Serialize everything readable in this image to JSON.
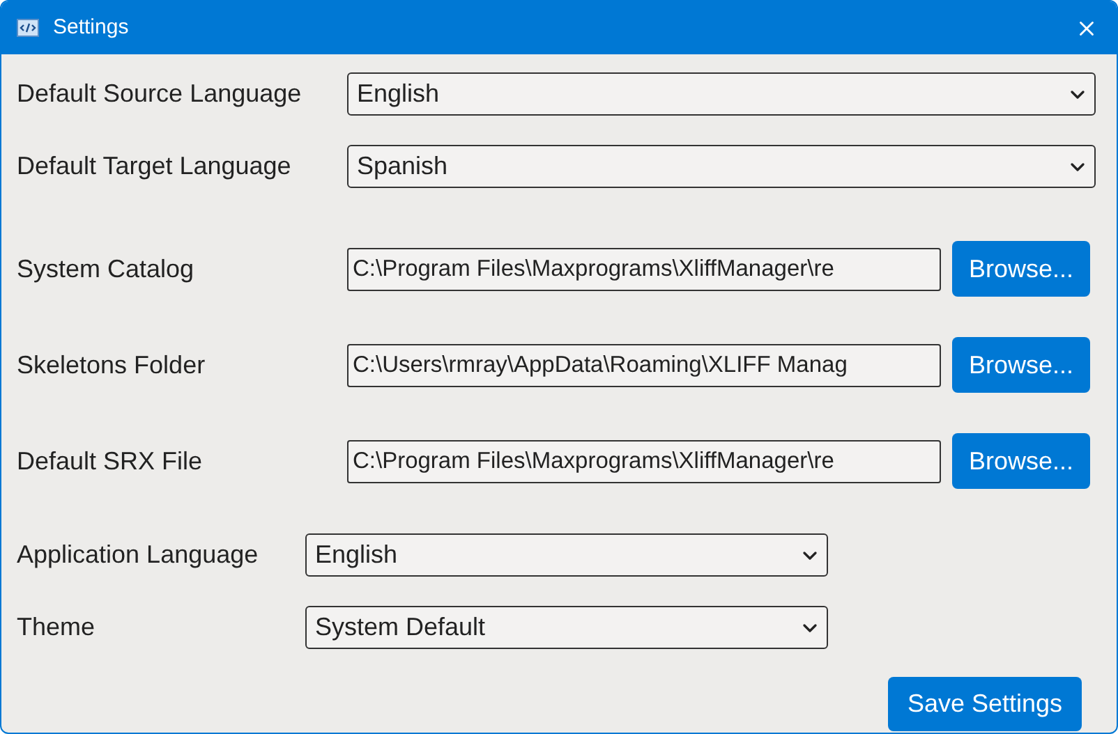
{
  "window": {
    "title": "Settings"
  },
  "language_rows": [
    {
      "label": "Default Source Language",
      "value": "English"
    },
    {
      "label": "Default Target Language",
      "value": "Spanish"
    }
  ],
  "path_rows": [
    {
      "label": "System Catalog",
      "value": "C:\\Program Files\\Maxprograms\\XliffManager\\re",
      "button": "Browse..."
    },
    {
      "label": "Skeletons Folder",
      "value": "C:\\Users\\rmray\\AppData\\Roaming\\XLIFF Manag",
      "button": "Browse..."
    },
    {
      "label": "Default SRX File",
      "value": "C:\\Program Files\\Maxprograms\\XliffManager\\re",
      "button": "Browse..."
    }
  ],
  "app_rows": [
    {
      "label": "Application Language",
      "value": "English"
    },
    {
      "label": "Theme",
      "value": "System Default"
    }
  ],
  "save_button": "Save Settings"
}
